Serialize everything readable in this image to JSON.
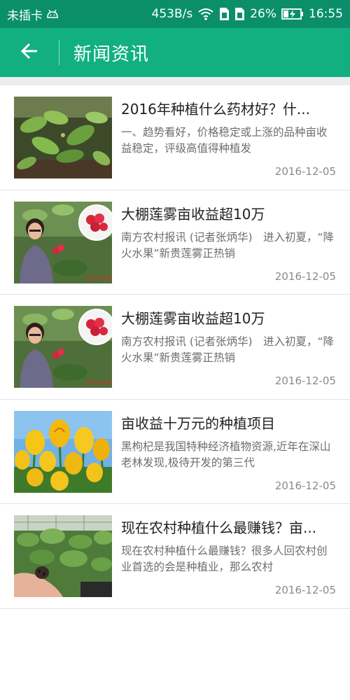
{
  "status_bar": {
    "carrier": "未插卡",
    "speed": "453B/s",
    "battery": "26%",
    "time": "16:55",
    "icons": [
      "android-icon",
      "wifi-icon",
      "sim-icon",
      "sim-icon",
      "battery-charging-icon"
    ]
  },
  "app_bar": {
    "title": "新闻资讯",
    "back_icon": "arrow-left-icon",
    "color": "#12b081"
  },
  "news": [
    {
      "title": "2016年种植什么药材好？什...",
      "summary": "一、趋势看好，价格稳定或上涨的品种亩收益稳定，评级高值得种植发",
      "date": "2016-12-05",
      "image": "green-plant-photo"
    },
    {
      "title": "大棚莲雾亩收益超10万",
      "summary": "南方农村报讯 (记者张炳华)　进入初夏，“降火水果”新贵莲雾正热销",
      "date": "2016-12-05",
      "image": "wax-apple-farmer-photo"
    },
    {
      "title": "大棚莲雾亩收益超10万",
      "summary": "南方农村报讯 (记者张炳华)　进入初夏，“降火水果”新贵莲雾正热销",
      "date": "2016-12-05",
      "image": "wax-apple-farmer-photo"
    },
    {
      "title": "亩收益十万元的种植项目",
      "summary": "黑枸杞是我国特种经济植物资源,近年在深山老林发现,极待开发的第三代",
      "date": "2016-12-05",
      "image": "yellow-tulips-photo"
    },
    {
      "title": "现在农村种植什么最赚钱？亩...",
      "summary": "现在农村种植什么最赚钱？很多人回农村创业首选的会是种植业，那么农村",
      "date": "2016-12-05",
      "image": "seedlings-greenhouse-photo"
    }
  ]
}
